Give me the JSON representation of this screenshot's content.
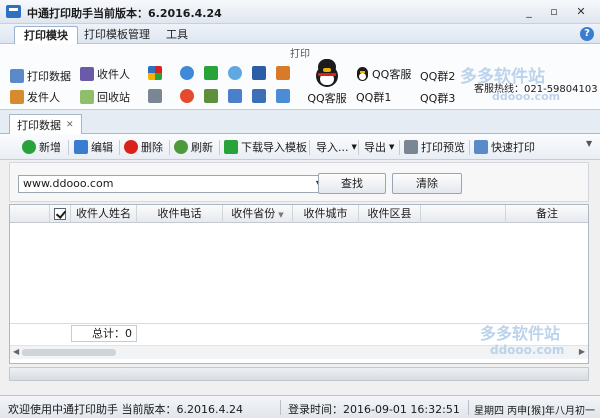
{
  "window": {
    "title": "中通打印助手当前版本：6.2016.4.24",
    "minimize": "_",
    "restore": "▫",
    "close": "✕"
  },
  "menu": {
    "tabs": [
      {
        "label": "打印模块"
      },
      {
        "label": "打印模板管理"
      },
      {
        "label": "工具"
      }
    ],
    "help": "?"
  },
  "ribbon": {
    "group_title": "打印",
    "print_data": "打印数据",
    "recipient": "收件人",
    "sender": "发件人",
    "recycle": "回收站",
    "qq_service_big": "QQ客服",
    "qq_service": "QQ客服",
    "qq_group1": "QQ群1",
    "qq_group2": "QQ群2",
    "qq_group3": "QQ群3",
    "hotline": "客服热线：021-59804103"
  },
  "watermark": {
    "top_cn": "多多软件站",
    "top_en": "ddooo.com",
    "bottom_cn": "多多软件站",
    "bottom_en": "ddooo.com"
  },
  "doc_tab": {
    "label": "打印数据",
    "close": "✕"
  },
  "toolbar": {
    "add": "新增",
    "edit": "编辑",
    "delete": "删除",
    "refresh": "刷新",
    "download_template": "下载导入模板",
    "import": "导入...",
    "export": "导出",
    "print_preview": "打印预览",
    "quick_print": "快速打印"
  },
  "search": {
    "url": "www.ddooo.com",
    "find": "查找",
    "clear": "清除"
  },
  "grid": {
    "columns": [
      "收件人姓名",
      "收件电话",
      "收件省份",
      "收件城市",
      "收件区县",
      "备注"
    ],
    "total": "总计：0"
  },
  "status": {
    "welcome": "欢迎使用中通打印助手 当前版本：6.2016.4.24",
    "login": "登录时间：2016-09-01 16:32:51",
    "date": "星期四 丙申[猴]年八月初一"
  },
  "colors": {
    "accent": "#2f6fc2",
    "red": "#d8231c",
    "green": "#27a33a"
  }
}
